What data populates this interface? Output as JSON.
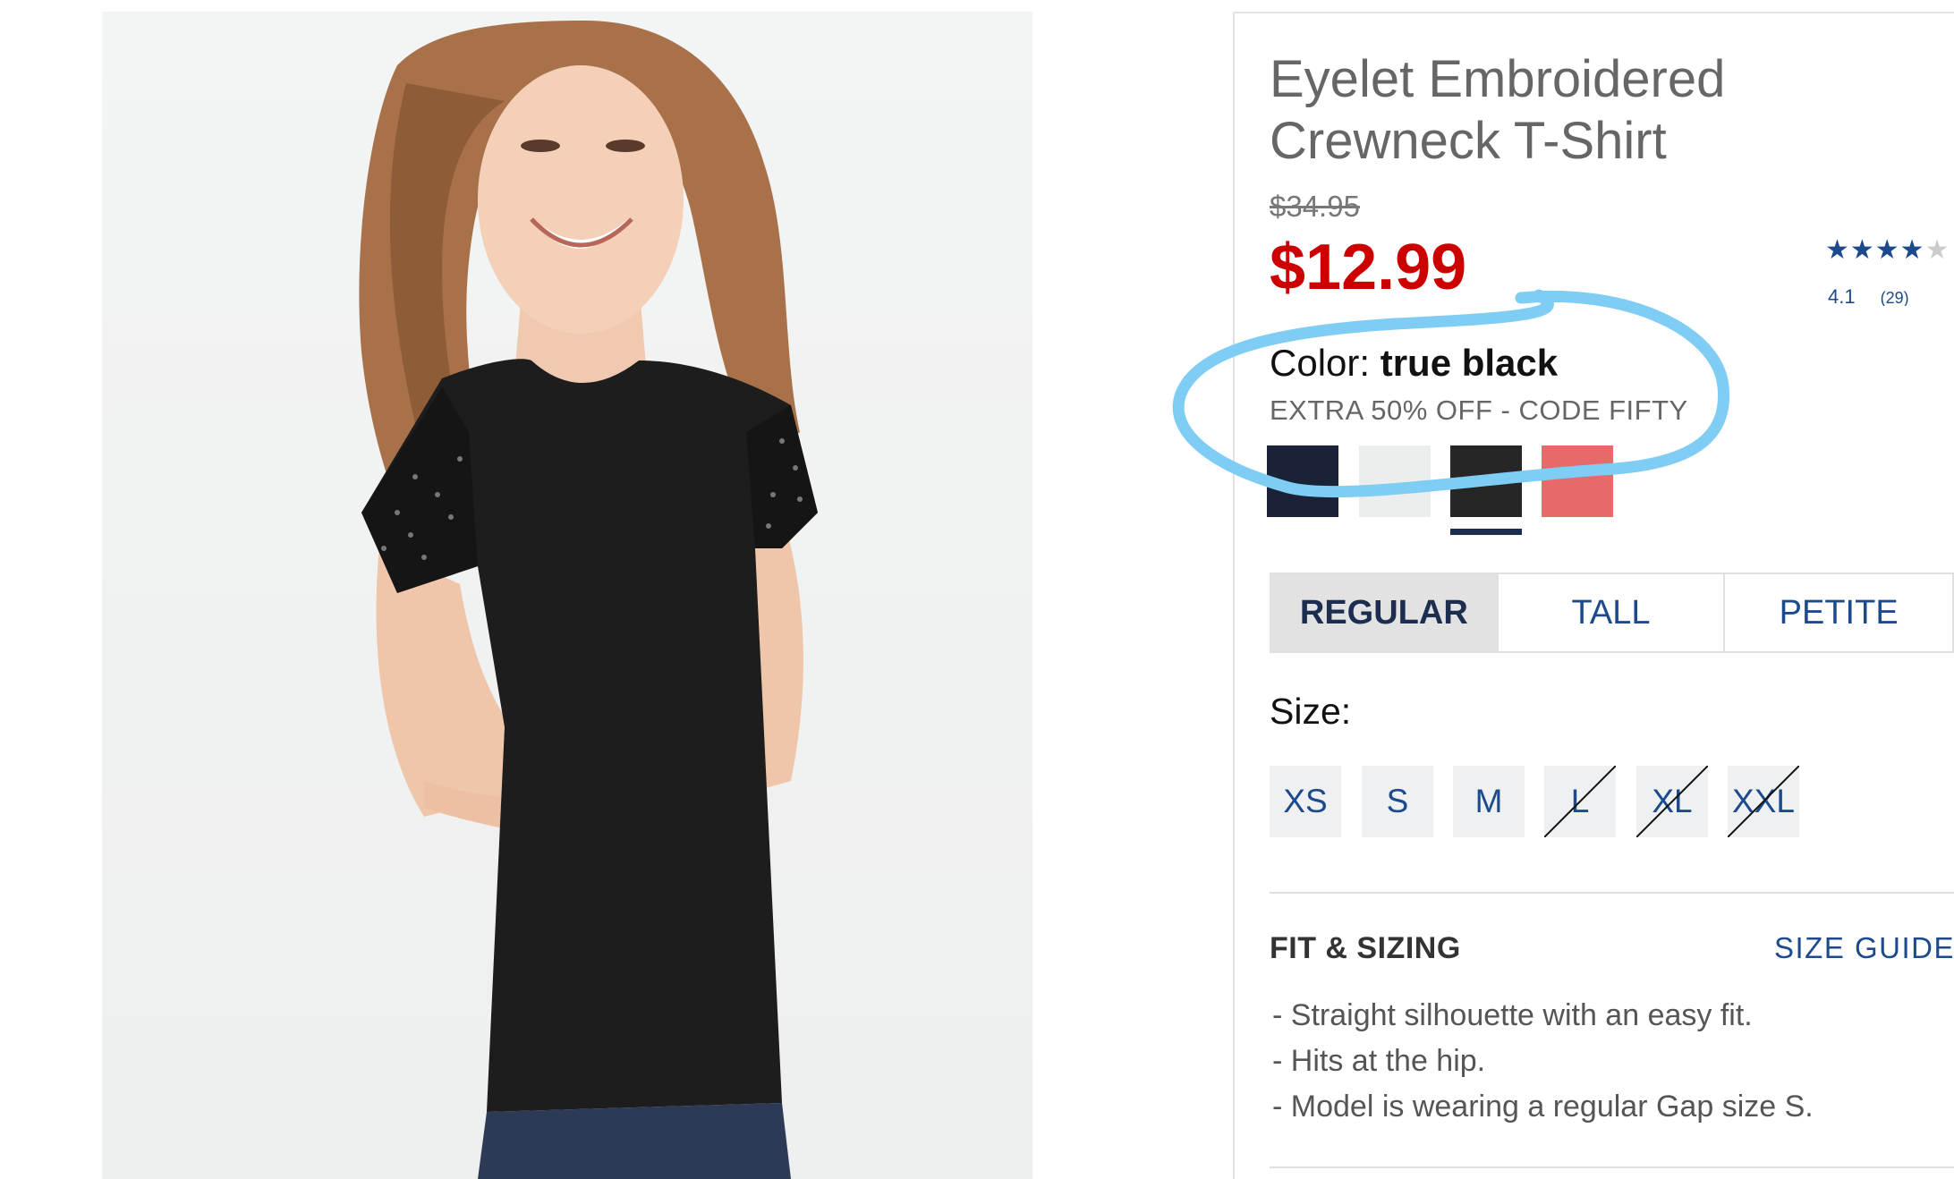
{
  "product": {
    "title_line1": "Eyelet Embroidered",
    "title_line2": "Crewneck T-Shirt",
    "original_price": "$34.95",
    "sale_price": "$12.99",
    "rating": {
      "stars_filled": "★★★★",
      "stars_empty": "★",
      "value": "4.1",
      "count": "(29)"
    }
  },
  "color": {
    "label": "Color:",
    "selected": "true black",
    "promo": "EXTRA 50% OFF - CODE FIFTY",
    "swatches": [
      {
        "name": "navy",
        "hex": "#1a2238"
      },
      {
        "name": "white",
        "hex": "#eceeee"
      },
      {
        "name": "true black",
        "hex": "#262626"
      },
      {
        "name": "coral",
        "hex": "#e8696a"
      }
    ]
  },
  "fit_tabs": [
    {
      "label": "REGULAR",
      "active": true
    },
    {
      "label": "TALL",
      "active": false
    },
    {
      "label": "PETITE",
      "active": false
    }
  ],
  "size": {
    "label": "Size:",
    "options": [
      {
        "label": "XS",
        "available": true
      },
      {
        "label": "S",
        "available": true
      },
      {
        "label": "M",
        "available": true
      },
      {
        "label": "L",
        "available": false
      },
      {
        "label": "XL",
        "available": false
      },
      {
        "label": "XXL",
        "available": false
      }
    ]
  },
  "fit_sizing": {
    "heading": "FIT & SIZING",
    "size_guide": "SIZE GUIDE",
    "bullets": [
      "Straight silhouette with an easy fit.",
      "Hits at the hip.",
      "Model is wearing a regular Gap size S."
    ]
  },
  "colors": {
    "accent": "#1c4a8c",
    "sale": "#cc0000",
    "annotation": "#7fcdf5"
  }
}
